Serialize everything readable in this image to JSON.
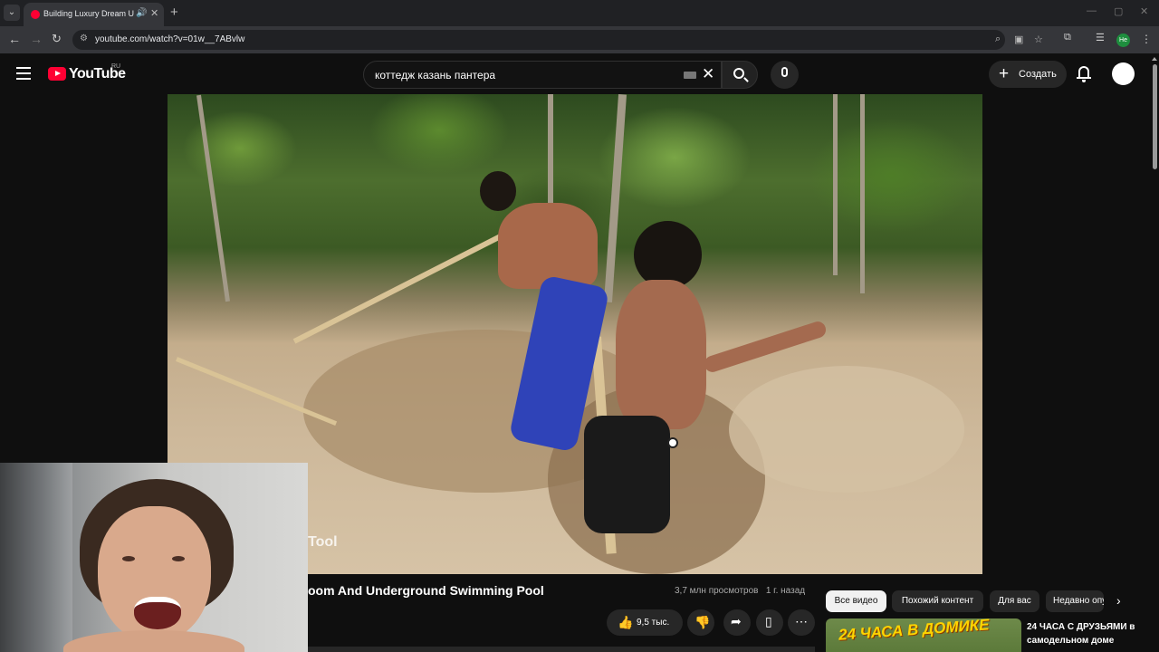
{
  "browser": {
    "tab_title": "Building Luxury Dream Und",
    "url": "youtube.com/watch?v=01w__7ABvlw",
    "profile_initials": "Не"
  },
  "header": {
    "logo_text": "YouTube",
    "region": "RU",
    "search_query": "коттедж казань пантера",
    "create_label": "Создать"
  },
  "video": {
    "overlay_text": "Tool",
    "title": "oom And Underground Swimming Pool",
    "views": "3,7 млн просмотров",
    "published": "1 г. назад",
    "likes": "9,5 тыс."
  },
  "chips": [
    "Все видео",
    "Похожий контент",
    "Для вас",
    "Недавно опубликованные"
  ],
  "recommendation": {
    "thumb_text": "24 ЧАСА В ДОМИКЕ",
    "title": "24 ЧАСА С ДРУЗЬЯМИ в самодельном доме"
  },
  "colors": {
    "brand": "#ff0033",
    "background": "#0f0f0f",
    "chip_active": "#f1f1f1"
  }
}
